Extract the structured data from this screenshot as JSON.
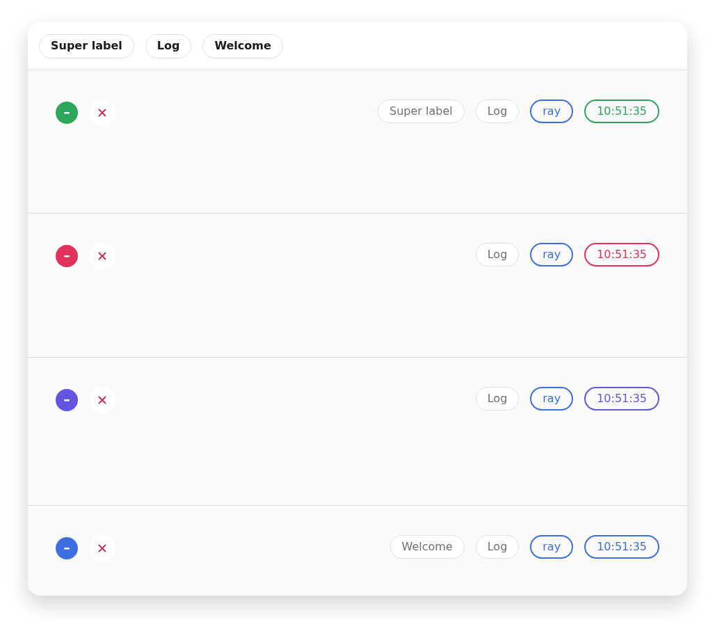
{
  "filters": [
    "Super label",
    "Log",
    "Welcome"
  ],
  "entries": [
    {
      "color": "#2fa65a",
      "labels": [
        "Super label",
        "Log"
      ],
      "user": "ray",
      "time": "10:51:35"
    },
    {
      "color": "#e0325a",
      "labels": [
        "Log"
      ],
      "user": "ray",
      "time": "10:51:35"
    },
    {
      "color": "#6455e0",
      "labels": [
        "Log"
      ],
      "user": "ray",
      "time": "10:51:35"
    },
    {
      "color": "#3d6fe3",
      "labels": [
        "Welcome",
        "Log"
      ],
      "user": "ray",
      "time": "10:51:35"
    }
  ]
}
